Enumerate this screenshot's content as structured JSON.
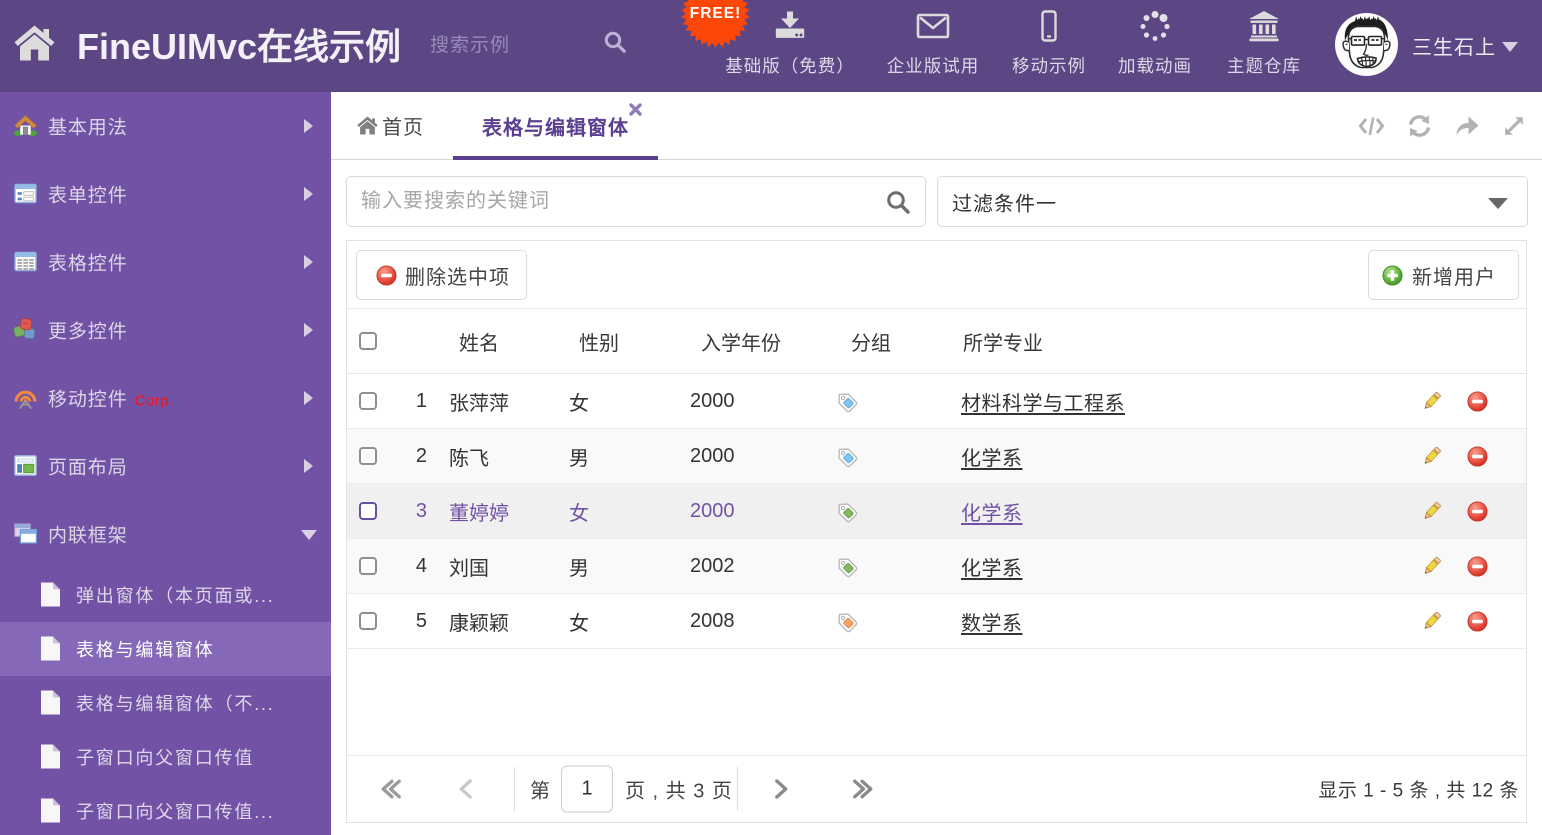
{
  "colors": {
    "header_bg": "#5d4684",
    "sidebar_bg": "#7252a5",
    "accent": "#5b3f90",
    "selected_menu_bg": "#8568b8",
    "free_badge": "#fc4708",
    "tag_blue": "#83c4f1",
    "tag_green": "#88b761",
    "tag_orange": "#f4a56a"
  },
  "header": {
    "title": "FineUIMvc在线示例",
    "search_placeholder": "搜索示例",
    "free_badge": "FREE!",
    "nav": [
      {
        "label": "基础版（免费）",
        "icon": "download-icon"
      },
      {
        "label": "企业版试用",
        "icon": "envelope-icon"
      },
      {
        "label": "移动示例",
        "icon": "mobile-icon"
      },
      {
        "label": "加载动画",
        "icon": "spinner-icon"
      },
      {
        "label": "主题仓库",
        "icon": "bank-icon"
      }
    ],
    "user": {
      "name": "三生石上"
    }
  },
  "sidebar": {
    "items": [
      {
        "label": "基本用法"
      },
      {
        "label": "表单控件"
      },
      {
        "label": "表格控件"
      },
      {
        "label": "更多控件"
      },
      {
        "label": "移动控件",
        "badge": "Corp."
      },
      {
        "label": "页面布局"
      },
      {
        "label": "内联框架",
        "expanded": true
      }
    ],
    "subitems": [
      {
        "label": "弹出窗体（本页面或..."
      },
      {
        "label": "表格与编辑窗体",
        "selected": true
      },
      {
        "label": "表格与编辑窗体（不..."
      },
      {
        "label": "子窗口向父窗口传值"
      },
      {
        "label": "子窗口向父窗口传值..."
      }
    ]
  },
  "tabs": {
    "home": "首页",
    "active": "表格与编辑窗体"
  },
  "filter": {
    "search_placeholder": "输入要搜索的关键词",
    "dropdown_value": "过滤条件一"
  },
  "toolbar": {
    "delete_label": "删除选中项",
    "add_label": "新增用户"
  },
  "table": {
    "columns": [
      "姓名",
      "性别",
      "入学年份",
      "分组",
      "所学专业"
    ],
    "rows": [
      {
        "num": "1",
        "name": "张萍萍",
        "gender": "女",
        "year": "2000",
        "tag_color": "blue",
        "major": "材料科学与工程系",
        "selected": false
      },
      {
        "num": "2",
        "name": "陈飞",
        "gender": "男",
        "year": "2000",
        "tag_color": "blue",
        "major": "化学系",
        "selected": false
      },
      {
        "num": "3",
        "name": "董婷婷",
        "gender": "女",
        "year": "2000",
        "tag_color": "green",
        "major": "化学系",
        "selected": true
      },
      {
        "num": "4",
        "name": "刘国",
        "gender": "男",
        "year": "2002",
        "tag_color": "green",
        "major": "化学系",
        "selected": false
      },
      {
        "num": "5",
        "name": "康颖颖",
        "gender": "女",
        "year": "2008",
        "tag_color": "orange",
        "major": "数学系",
        "selected": false
      }
    ]
  },
  "pager": {
    "page_prefix": "第",
    "page_value": "1",
    "page_suffix": "页 , 共 3 页",
    "info": "显示 1 - 5 条 , 共 12 条"
  }
}
